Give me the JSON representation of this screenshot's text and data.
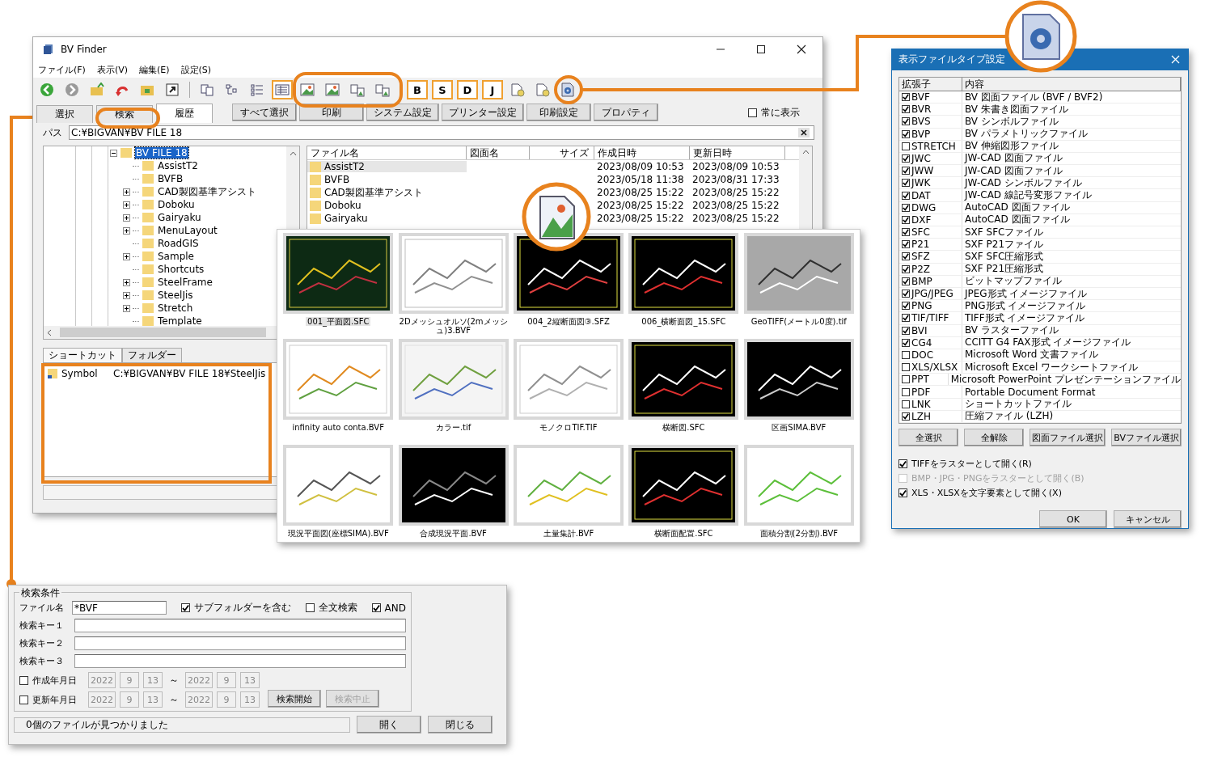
{
  "main_window": {
    "title": "BV Finder",
    "menu": [
      "ファイル(F)",
      "表示(V)",
      "編集(E)",
      "設定(S)"
    ],
    "toolbar": [
      {
        "kind": "back",
        "selected": false
      },
      {
        "kind": "forward",
        "selected": false
      },
      {
        "kind": "folder-up",
        "selected": false
      },
      {
        "kind": "undo",
        "selected": false
      },
      {
        "kind": "folder",
        "selected": false
      },
      {
        "kind": "jump",
        "selected": false
      },
      {
        "kind": "separator"
      },
      {
        "kind": "large-icons",
        "selected": false
      },
      {
        "kind": "small-icons",
        "selected": false
      },
      {
        "kind": "list",
        "selected": false
      },
      {
        "kind": "details",
        "selected": true
      },
      {
        "kind": "image-large",
        "selected": false
      },
      {
        "kind": "image",
        "selected": false
      },
      {
        "kind": "image-small",
        "selected": false
      },
      {
        "kind": "image-multi",
        "selected": false
      },
      {
        "kind": "separator"
      },
      {
        "kind": "letter",
        "label": "B",
        "selected": true
      },
      {
        "kind": "letter",
        "label": "S",
        "selected": true
      },
      {
        "kind": "letter",
        "label": "D",
        "selected": true
      },
      {
        "kind": "letter",
        "label": "J",
        "selected": true
      },
      {
        "kind": "doc",
        "selected": false
      },
      {
        "kind": "doc",
        "selected": false
      },
      {
        "kind": "gear-doc",
        "selected": false
      }
    ],
    "tabs": [
      {
        "label": "選択",
        "selected": false
      },
      {
        "label": "検索",
        "selected": false
      },
      {
        "label": "履歴",
        "selected": true
      }
    ],
    "buttons": [
      "すべて選択",
      "印刷",
      "システム設定",
      "プリンター設定",
      "印刷設定",
      "プロパティ"
    ],
    "always_show": {
      "label": "常に表示",
      "checked": false
    },
    "path": {
      "label": "パス",
      "value": "C:¥BIGVAN¥BV FILE 18"
    },
    "tree": {
      "label": "BV FILE 18",
      "expanded": true,
      "selected": true,
      "children": [
        {
          "label": "AssistT2",
          "expandable": false
        },
        {
          "label": "BVFB",
          "expandable": false
        },
        {
          "label": "CAD製図基準アシスト",
          "expandable": true
        },
        {
          "label": "Doboku",
          "expandable": true
        },
        {
          "label": "Gairyaku",
          "expandable": true
        },
        {
          "label": "MenuLayout",
          "expandable": true
        },
        {
          "label": "RoadGIS",
          "expandable": false
        },
        {
          "label": "Sample",
          "expandable": true
        },
        {
          "label": "Shortcuts",
          "expandable": false
        },
        {
          "label": "SteelFrame",
          "expandable": true
        },
        {
          "label": "SteelJis",
          "expandable": true
        },
        {
          "label": "Stretch",
          "expandable": true
        },
        {
          "label": "Template",
          "expandable": false
        }
      ]
    },
    "shortcut_panel": {
      "tabs": [
        {
          "label": "ショートカット",
          "selected": true
        },
        {
          "label": "フォルダー",
          "selected": false
        }
      ],
      "items": [
        {
          "name": "Symbol",
          "path": "C:¥BIGVAN¥BV FILE 18¥SteelJis"
        }
      ]
    },
    "file_list": {
      "columns": [
        "ファイル名",
        "図面名",
        "サイズ",
        "作成日時",
        "更新日時"
      ],
      "rows": [
        {
          "name": "AssistT2",
          "created": "2023/08/09 10:53",
          "modified": "2023/08/09 10:53",
          "selected": true
        },
        {
          "name": "BVFB",
          "created": "2023/05/18 11:38",
          "modified": "2023/08/31 17:33",
          "selected": false
        },
        {
          "name": "CAD製図基準アシスト",
          "created": "2023/08/25 15:22",
          "modified": "2023/08/25 15:22",
          "selected": false
        },
        {
          "name": "Doboku",
          "created": "2023/08/25 15:22",
          "modified": "2023/08/25 15:22",
          "selected": false
        },
        {
          "name": "Gairyaku",
          "created": "2023/08/25 15:22",
          "modified": "2023/08/25 15:22",
          "selected": false
        }
      ]
    }
  },
  "thumbnail_panel": {
    "items": [
      {
        "caption": "001_平面図.SFC",
        "kind": "contour-dark",
        "selected": true
      },
      {
        "caption": "2Dメッシュオルソ(2mメッシュ)3.BVF",
        "kind": "mesh",
        "selected": false
      },
      {
        "caption": "004_2縦断面図③.SFZ",
        "kind": "profile-dark",
        "selected": false
      },
      {
        "caption": "006_横断面図_15.SFC",
        "kind": "section-dark",
        "selected": false
      },
      {
        "caption": "GeoTIFF(メートル0度).tif",
        "kind": "aerial",
        "selected": false
      },
      {
        "caption": "infinity auto conta.BVF",
        "kind": "contour-light",
        "selected": false
      },
      {
        "caption": "カラー.tif",
        "kind": "map",
        "selected": false
      },
      {
        "caption": "モノクロTIF.TIF",
        "kind": "blueprint",
        "selected": false
      },
      {
        "caption": "横断図.SFC",
        "kind": "section-dark",
        "selected": false
      },
      {
        "caption": "区画SIMA.BVF",
        "kind": "parcel-dark",
        "selected": false
      },
      {
        "caption": "現況平面図(座標SIMA).BVF",
        "kind": "points",
        "selected": false
      },
      {
        "caption": "合成現況平面.BVF",
        "kind": "composite",
        "selected": false
      },
      {
        "caption": "土量集計.BVF",
        "kind": "earthwork",
        "selected": false
      },
      {
        "caption": "横断面配置.SFC",
        "kind": "section-dark",
        "selected": false
      },
      {
        "caption": "面積分割(2分割).BVF",
        "kind": "area",
        "selected": false
      }
    ]
  },
  "file_type_dialog": {
    "title": "表示ファイルタイプ設定",
    "columns": [
      "拡張子",
      "内容"
    ],
    "rows": [
      {
        "ext": "BVF",
        "desc": "BV 図面ファイル (BVF / BVF2)",
        "checked": true
      },
      {
        "ext": "BVR",
        "desc": "BV 朱書き図面ファイル",
        "checked": true
      },
      {
        "ext": "BVS",
        "desc": "BV シンボルファイル",
        "checked": true
      },
      {
        "ext": "BVP",
        "desc": "BV パラメトリックファイル",
        "checked": true
      },
      {
        "ext": "STRETCH",
        "desc": "BV 伸縮図形ファイル",
        "checked": false
      },
      {
        "ext": "JWC",
        "desc": "JW-CAD 図面ファイル",
        "checked": true
      },
      {
        "ext": "JWW",
        "desc": "JW-CAD 図面ファイル",
        "checked": true
      },
      {
        "ext": "JWK",
        "desc": "JW-CAD シンボルファイル",
        "checked": true
      },
      {
        "ext": "DAT",
        "desc": "JW-CAD 線記号変形ファイル",
        "checked": true
      },
      {
        "ext": "DWG",
        "desc": "AutoCAD 図面ファイル",
        "checked": true
      },
      {
        "ext": "DXF",
        "desc": "AutoCAD 図面ファイル",
        "checked": true
      },
      {
        "ext": "SFC",
        "desc": "SXF SFCファイル",
        "checked": true
      },
      {
        "ext": "P21",
        "desc": "SXF P21ファイル",
        "checked": true
      },
      {
        "ext": "SFZ",
        "desc": "SXF SFC圧縮形式",
        "checked": true
      },
      {
        "ext": "P2Z",
        "desc": "SXF P21圧縮形式",
        "checked": true
      },
      {
        "ext": "BMP",
        "desc": "ビットマップファイル",
        "checked": true
      },
      {
        "ext": "JPG/JPEG",
        "desc": "JPEG形式 イメージファイル",
        "checked": true
      },
      {
        "ext": "PNG",
        "desc": "PNG形式 イメージファイル",
        "checked": true
      },
      {
        "ext": "TIF/TIFF",
        "desc": "TIFF形式 イメージファイル",
        "checked": true
      },
      {
        "ext": "BVI",
        "desc": "BV ラスターファイル",
        "checked": true
      },
      {
        "ext": "CG4",
        "desc": "CCITT G4 FAX形式 イメージファイル",
        "checked": true
      },
      {
        "ext": "DOC",
        "desc": "Microsoft Word 文書ファイル",
        "checked": false
      },
      {
        "ext": "XLS/XLSX",
        "desc": "Microsoft Excel ワークシートファイル",
        "checked": false
      },
      {
        "ext": "PPT",
        "desc": "Microsoft PowerPoint プレゼンテーションファイル",
        "checked": false
      },
      {
        "ext": "PDF",
        "desc": "Portable Document Format",
        "checked": false
      },
      {
        "ext": "LNK",
        "desc": "ショートカットファイル",
        "checked": false
      },
      {
        "ext": "LZH",
        "desc": "圧縮ファイル (LZH)",
        "checked": true
      }
    ],
    "select_buttons": [
      "全選択",
      "全解除",
      "図面ファイル選択",
      "BVファイル選択"
    ],
    "options": [
      {
        "label": "TIFFをラスターとして開く(R)",
        "checked": true,
        "disabled": false
      },
      {
        "label": "BMP・JPG・PNGをラスターとして開く(B)",
        "checked": false,
        "disabled": true
      },
      {
        "label": "XLS・XLSXを文字要素として開く(X)",
        "checked": true,
        "disabled": false
      }
    ],
    "ok": "OK",
    "cancel": "キャンセル"
  },
  "search_dialog": {
    "group": "検索条件",
    "filename": {
      "label": "ファイル名",
      "value": "*BVF"
    },
    "flags": [
      {
        "label": "サブフォルダーを含む",
        "checked": true
      },
      {
        "label": "全文検索",
        "checked": false
      },
      {
        "label": "AND",
        "checked": true
      }
    ],
    "keys": [
      {
        "label": "検索キー１"
      },
      {
        "label": "検索キー２"
      },
      {
        "label": "検索キー３"
      }
    ],
    "dates": [
      {
        "label": "作成年月日",
        "checked": false,
        "from": [
          "2022",
          "9",
          "13"
        ],
        "separator": "～",
        "to": [
          "2022",
          "9",
          "13"
        ]
      },
      {
        "label": "更新年月日",
        "checked": false,
        "from": [
          "2022",
          "9",
          "13"
        ],
        "separator": "～",
        "to": [
          "2022",
          "9",
          "13"
        ]
      }
    ],
    "start": {
      "label": "検索開始",
      "disabled": false
    },
    "stop": {
      "label": "検索中止",
      "disabled": true
    },
    "status": "0個のファイルが見つかりました",
    "open": "開く",
    "close": "閉じる"
  }
}
